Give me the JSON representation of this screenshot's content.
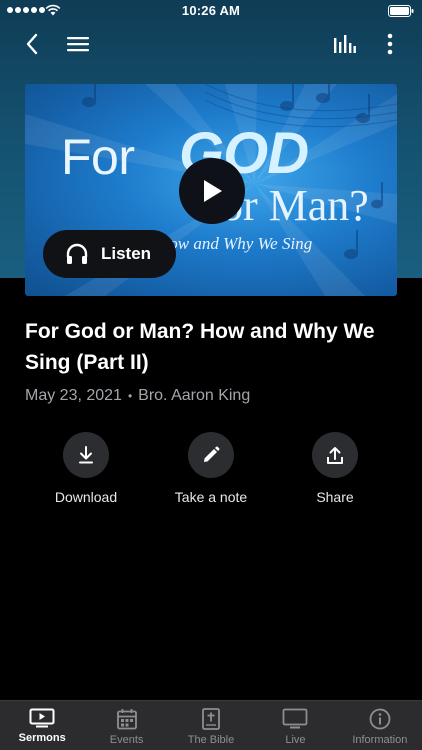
{
  "status_bar": {
    "time": "10:26 AM"
  },
  "artwork": {
    "title_part1": "For",
    "title_part2": "GOD",
    "title_part3": "or Man?",
    "subtitle": "How and Why We Sing",
    "listen_label": "Listen"
  },
  "sermon": {
    "title": "For God or Man? How and Why We Sing (Part II)",
    "date": "May 23, 2021",
    "separator": "•",
    "speaker": "Bro. Aaron King"
  },
  "actions": [
    {
      "label": "Download",
      "icon": "download-icon"
    },
    {
      "label": "Take a note",
      "icon": "pencil-icon"
    },
    {
      "label": "Share",
      "icon": "share-icon"
    }
  ],
  "tabs": [
    {
      "label": "Sermons",
      "icon": "play-screen-icon",
      "active": true
    },
    {
      "label": "Events",
      "icon": "calendar-icon",
      "active": false
    },
    {
      "label": "The Bible",
      "icon": "bible-icon",
      "active": false
    },
    {
      "label": "Live",
      "icon": "tv-icon",
      "active": false
    },
    {
      "label": "Information",
      "icon": "info-icon",
      "active": false
    }
  ],
  "colors": {
    "header": "#14506e",
    "background": "#000000",
    "tab_bar": "#2c2c2e",
    "action_circle": "#2b2d30",
    "meta_text": "#a2a6ab"
  }
}
